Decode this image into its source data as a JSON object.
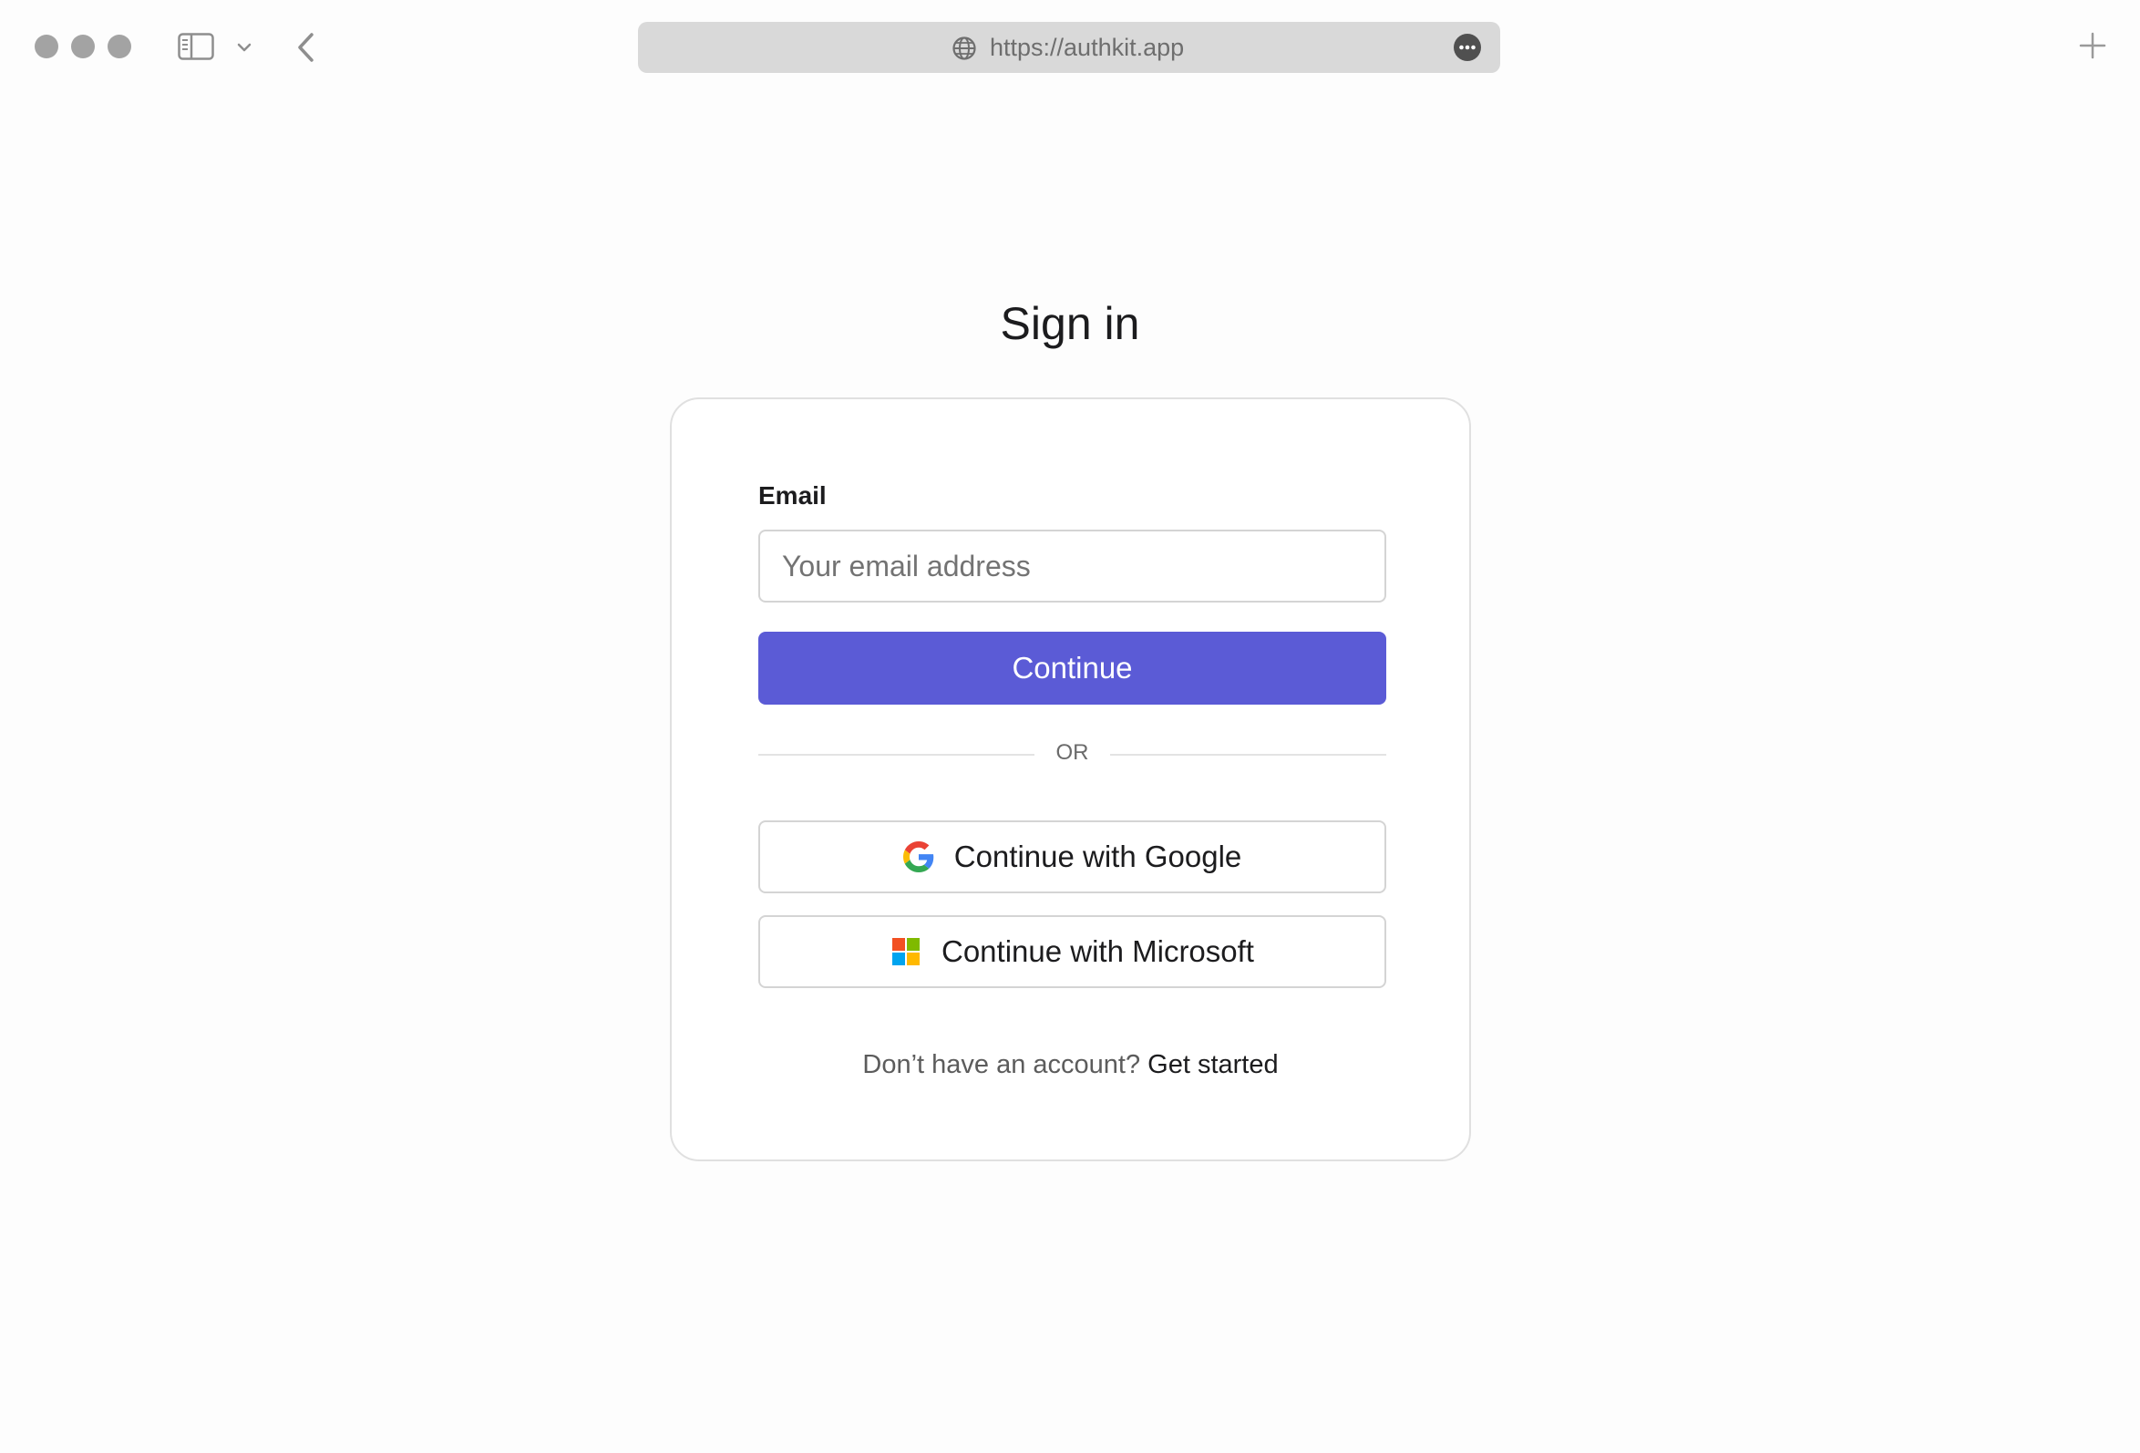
{
  "browser": {
    "url": "https://authkit.app"
  },
  "page": {
    "title": "Sign in"
  },
  "form": {
    "email_label": "Email",
    "email_placeholder": "Your email address",
    "email_value": "",
    "continue_label": "Continue",
    "divider_text": "OR",
    "google_label": "Continue with Google",
    "microsoft_label": "Continue with Microsoft",
    "signup_prompt": "Don’t have an account?",
    "signup_link": "Get started"
  },
  "icons": {
    "globe": "globe-icon",
    "more": "more-icon",
    "back": "chevron-left-icon",
    "sidebar": "sidebar-icon",
    "new_tab": "plus-icon",
    "google": "google-logo-icon",
    "microsoft": "microsoft-logo-icon"
  },
  "colors": {
    "accent": "#5b5bd6",
    "traffic_light": "#a3a3a3",
    "address_bar": "#d9d9d9"
  }
}
